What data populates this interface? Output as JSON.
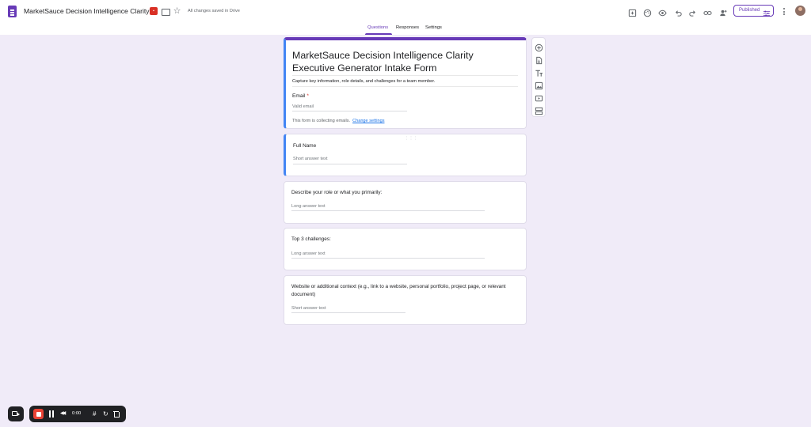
{
  "header": {
    "doc_title": "MarketSauce Decision Intelligence Clarity Executi",
    "saved_status": "All changes saved in Drive",
    "publish_label": "Published"
  },
  "tabs": [
    {
      "label": "Questions",
      "active": true
    },
    {
      "label": "Responses",
      "active": false
    },
    {
      "label": "Settings",
      "active": false
    }
  ],
  "form": {
    "title": "MarketSauce Decision Intelligence Clarity Executive Generator Intake Form",
    "description": "Capture key information, role details, and challenges for a team member.",
    "email": {
      "label": "Email",
      "required_mark": "*",
      "placeholder": "Valid email",
      "collecting_note": "This form is collecting emails.",
      "change_link": "Change settings"
    },
    "questions": [
      {
        "label": "Full Name",
        "placeholder": "Short answer text"
      },
      {
        "label": "Describe your role or what you primarily:",
        "placeholder": "Long answer text"
      },
      {
        "label": "Top 3 challenges:",
        "placeholder": "Long answer text"
      },
      {
        "label": "Website or additional context (e.g., link to a website, personal portfolio, project page, or relevant document)",
        "placeholder": "Short answer text"
      }
    ]
  },
  "recorder": {
    "timer": "0:00"
  },
  "colors": {
    "accent": "#673ab7",
    "focus": "#4285f4",
    "background": "#f0ebf8",
    "stop": "#ea4335"
  }
}
